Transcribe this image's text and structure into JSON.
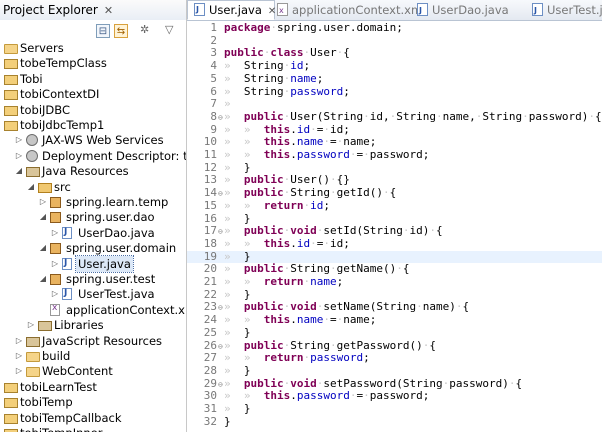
{
  "explorer": {
    "title": "Project Explorer",
    "close_glyph": "✕",
    "toolbar": {
      "collapse_all": "⊟",
      "link_with_editor": "⇆",
      "view_menu": "▽"
    },
    "tree": [
      {
        "depth": 0,
        "label": "Servers",
        "icon": "folder",
        "arrow": ""
      },
      {
        "depth": 0,
        "label": "tobeTempClass",
        "icon": "project-folder",
        "arrow": ""
      },
      {
        "depth": 0,
        "label": "Tobi",
        "icon": "project-folder",
        "arrow": ""
      },
      {
        "depth": 0,
        "label": "tobiContextDI",
        "icon": "project-folder",
        "arrow": ""
      },
      {
        "depth": 0,
        "label": "tobiJDBC",
        "icon": "project-folder",
        "arrow": ""
      },
      {
        "depth": 0,
        "label": "tobiJdbcTemp1",
        "icon": "project-folder",
        "arrow": ""
      },
      {
        "depth": 1,
        "label": "JAX-WS Web Services",
        "icon": "gear",
        "arrow": "▷"
      },
      {
        "depth": 1,
        "label": "Deployment Descriptor: tobiJdbc",
        "icon": "gear",
        "arrow": "▷"
      },
      {
        "depth": 1,
        "label": "Java Resources",
        "icon": "java-resources",
        "arrow": "◢"
      },
      {
        "depth": 2,
        "label": "src",
        "icon": "source-folder",
        "arrow": "◢"
      },
      {
        "depth": 3,
        "label": "spring.learn.temp",
        "icon": "package",
        "arrow": "▷"
      },
      {
        "depth": 3,
        "label": "spring.user.dao",
        "icon": "package",
        "arrow": "◢"
      },
      {
        "depth": 4,
        "label": "UserDao.java",
        "icon": "java-file",
        "arrow": "▷"
      },
      {
        "depth": 3,
        "label": "spring.user.domain",
        "icon": "package",
        "arrow": "◢"
      },
      {
        "depth": 4,
        "label": "User.java",
        "icon": "java-file",
        "arrow": "▷",
        "selected": true
      },
      {
        "depth": 3,
        "label": "spring.user.test",
        "icon": "package",
        "arrow": "◢"
      },
      {
        "depth": 4,
        "label": "UserTest.java",
        "icon": "java-file",
        "arrow": "▷"
      },
      {
        "depth": 3,
        "label": "applicationContext.xml",
        "icon": "xml-file",
        "arrow": ""
      },
      {
        "depth": 2,
        "label": "Libraries",
        "icon": "libraries",
        "arrow": "▷"
      },
      {
        "depth": 1,
        "label": "JavaScript Resources",
        "icon": "libraries",
        "arrow": "▷"
      },
      {
        "depth": 1,
        "label": "build",
        "icon": "folder",
        "arrow": "▷"
      },
      {
        "depth": 1,
        "label": "WebContent",
        "icon": "folder",
        "arrow": "▷"
      },
      {
        "depth": 0,
        "label": "tobiLearnTest",
        "icon": "project-folder",
        "arrow": ""
      },
      {
        "depth": 0,
        "label": "tobiTemp",
        "icon": "project-folder",
        "arrow": ""
      },
      {
        "depth": 0,
        "label": "tobiTempCallback",
        "icon": "project-folder",
        "arrow": ""
      },
      {
        "depth": 0,
        "label": "tobiTempInner",
        "icon": "project-folder",
        "arrow": ""
      }
    ]
  },
  "editor": {
    "tabs": [
      {
        "label": "User.java",
        "icon": "java-file",
        "active": true,
        "close_glyph": "✕"
      },
      {
        "label": "applicationContext.xml",
        "icon": "xml-file",
        "active": false
      },
      {
        "label": "UserDao.java",
        "icon": "java-file",
        "active": false
      },
      {
        "label": "UserTest.java",
        "icon": "java-file",
        "active": false
      }
    ],
    "lines": [
      {
        "n": "1",
        "fold": "",
        "code": [
          [
            "kw",
            "package"
          ],
          [
            "ws",
            "·"
          ],
          [
            "t",
            "spring.user.domain;"
          ]
        ]
      },
      {
        "n": "2",
        "fold": "",
        "code": []
      },
      {
        "n": "3",
        "fold": "",
        "code": [
          [
            "kw",
            "public"
          ],
          [
            "ws",
            "·"
          ],
          [
            "kw",
            "class"
          ],
          [
            "ws",
            "·"
          ],
          [
            "t",
            "User"
          ],
          [
            "ws",
            "·"
          ],
          [
            "t",
            "{"
          ]
        ]
      },
      {
        "n": "4",
        "fold": "",
        "code": [
          [
            "ws",
            "»  "
          ],
          [
            "t",
            "String"
          ],
          [
            "ws",
            "·"
          ],
          [
            "fld",
            "id"
          ],
          [
            "t",
            ";"
          ]
        ]
      },
      {
        "n": "5",
        "fold": "",
        "code": [
          [
            "ws",
            "»  "
          ],
          [
            "t",
            "String"
          ],
          [
            "ws",
            "·"
          ],
          [
            "fld",
            "name"
          ],
          [
            "t",
            ";"
          ]
        ]
      },
      {
        "n": "6",
        "fold": "",
        "code": [
          [
            "ws",
            "»  "
          ],
          [
            "t",
            "String"
          ],
          [
            "ws",
            "·"
          ],
          [
            "fld",
            "password"
          ],
          [
            "t",
            ";"
          ]
        ]
      },
      {
        "n": "7",
        "fold": "",
        "code": [
          [
            "ws",
            "»"
          ]
        ]
      },
      {
        "n": "8",
        "fold": "⊖",
        "code": [
          [
            "ws",
            "»  "
          ],
          [
            "kw",
            "public"
          ],
          [
            "ws",
            "·"
          ],
          [
            "t",
            "User(String"
          ],
          [
            "ws",
            "·"
          ],
          [
            "t",
            "id,"
          ],
          [
            "ws",
            "·"
          ],
          [
            "t",
            "String"
          ],
          [
            "ws",
            "·"
          ],
          [
            "t",
            "name,"
          ],
          [
            "ws",
            "·"
          ],
          [
            "t",
            "String"
          ],
          [
            "ws",
            "·"
          ],
          [
            "t",
            "password)"
          ],
          [
            "ws",
            "·"
          ],
          [
            "t",
            "{"
          ]
        ]
      },
      {
        "n": "9",
        "fold": "",
        "code": [
          [
            "ws",
            "»  »  "
          ],
          [
            "kw",
            "this"
          ],
          [
            "t",
            "."
          ],
          [
            "fld",
            "id"
          ],
          [
            "ws",
            "·"
          ],
          [
            "t",
            "="
          ],
          [
            "ws",
            "·"
          ],
          [
            "t",
            "id;"
          ]
        ]
      },
      {
        "n": "10",
        "fold": "",
        "code": [
          [
            "ws",
            "»  »  "
          ],
          [
            "kw",
            "this"
          ],
          [
            "t",
            "."
          ],
          [
            "fld",
            "name"
          ],
          [
            "ws",
            "·"
          ],
          [
            "t",
            "="
          ],
          [
            "ws",
            "·"
          ],
          [
            "t",
            "name;"
          ]
        ]
      },
      {
        "n": "11",
        "fold": "",
        "code": [
          [
            "ws",
            "»  »  "
          ],
          [
            "kw",
            "this"
          ],
          [
            "t",
            "."
          ],
          [
            "fld",
            "password"
          ],
          [
            "ws",
            "·"
          ],
          [
            "t",
            "="
          ],
          [
            "ws",
            "·"
          ],
          [
            "t",
            "password;"
          ]
        ]
      },
      {
        "n": "12",
        "fold": "",
        "code": [
          [
            "ws",
            "»  "
          ],
          [
            "t",
            "}"
          ]
        ]
      },
      {
        "n": "13",
        "fold": "",
        "code": [
          [
            "ws",
            "»  "
          ],
          [
            "kw",
            "public"
          ],
          [
            "ws",
            "·"
          ],
          [
            "t",
            "User()"
          ],
          [
            "ws",
            "·"
          ],
          [
            "t",
            "{}"
          ]
        ]
      },
      {
        "n": "14",
        "fold": "⊖",
        "code": [
          [
            "ws",
            "»  "
          ],
          [
            "kw",
            "public"
          ],
          [
            "ws",
            "·"
          ],
          [
            "t",
            "String"
          ],
          [
            "ws",
            "·"
          ],
          [
            "t",
            "getId()"
          ],
          [
            "ws",
            "·"
          ],
          [
            "t",
            "{"
          ]
        ]
      },
      {
        "n": "15",
        "fold": "",
        "code": [
          [
            "ws",
            "»  »  "
          ],
          [
            "kw",
            "return"
          ],
          [
            "ws",
            "·"
          ],
          [
            "fld",
            "id"
          ],
          [
            "t",
            ";"
          ]
        ]
      },
      {
        "n": "16",
        "fold": "",
        "code": [
          [
            "ws",
            "»  "
          ],
          [
            "t",
            "}"
          ]
        ]
      },
      {
        "n": "17",
        "fold": "⊖",
        "code": [
          [
            "ws",
            "»  "
          ],
          [
            "kw",
            "public"
          ],
          [
            "ws",
            "·"
          ],
          [
            "kw",
            "void"
          ],
          [
            "ws",
            "·"
          ],
          [
            "t",
            "setId(String"
          ],
          [
            "ws",
            "·"
          ],
          [
            "t",
            "id)"
          ],
          [
            "ws",
            "·"
          ],
          [
            "t",
            "{"
          ]
        ]
      },
      {
        "n": "18",
        "fold": "",
        "code": [
          [
            "ws",
            "»  »  "
          ],
          [
            "kw",
            "this"
          ],
          [
            "t",
            "."
          ],
          [
            "fld",
            "id"
          ],
          [
            "ws",
            "·"
          ],
          [
            "t",
            "="
          ],
          [
            "ws",
            "·"
          ],
          [
            "t",
            "id;"
          ]
        ]
      },
      {
        "n": "19",
        "fold": "",
        "hl": true,
        "code": [
          [
            "ws",
            "»  "
          ],
          [
            "t",
            "}"
          ]
        ]
      },
      {
        "n": "20",
        "fold": "",
        "code": [
          [
            "ws",
            "»  "
          ],
          [
            "kw",
            "public"
          ],
          [
            "ws",
            "·"
          ],
          [
            "t",
            "String"
          ],
          [
            "ws",
            "·"
          ],
          [
            "t",
            "getName()"
          ],
          [
            "ws",
            "·"
          ],
          [
            "t",
            "{"
          ]
        ]
      },
      {
        "n": "21",
        "fold": "",
        "code": [
          [
            "ws",
            "»  »  "
          ],
          [
            "kw",
            "return"
          ],
          [
            "ws",
            "·"
          ],
          [
            "fld",
            "name"
          ],
          [
            "t",
            ";"
          ]
        ]
      },
      {
        "n": "22",
        "fold": "",
        "code": [
          [
            "ws",
            "»  "
          ],
          [
            "t",
            "}"
          ]
        ]
      },
      {
        "n": "23",
        "fold": "⊖",
        "code": [
          [
            "ws",
            "»  "
          ],
          [
            "kw",
            "public"
          ],
          [
            "ws",
            "·"
          ],
          [
            "kw",
            "void"
          ],
          [
            "ws",
            "·"
          ],
          [
            "t",
            "setName(String"
          ],
          [
            "ws",
            "·"
          ],
          [
            "t",
            "name)"
          ],
          [
            "ws",
            "·"
          ],
          [
            "t",
            "{"
          ]
        ]
      },
      {
        "n": "24",
        "fold": "",
        "code": [
          [
            "ws",
            "»  »  "
          ],
          [
            "kw",
            "this"
          ],
          [
            "t",
            "."
          ],
          [
            "fld",
            "name"
          ],
          [
            "ws",
            "·"
          ],
          [
            "t",
            "="
          ],
          [
            "ws",
            "·"
          ],
          [
            "t",
            "name;"
          ]
        ]
      },
      {
        "n": "25",
        "fold": "",
        "code": [
          [
            "ws",
            "»  "
          ],
          [
            "t",
            "}"
          ]
        ]
      },
      {
        "n": "26",
        "fold": "⊖",
        "code": [
          [
            "ws",
            "»  "
          ],
          [
            "kw",
            "public"
          ],
          [
            "ws",
            "·"
          ],
          [
            "t",
            "String"
          ],
          [
            "ws",
            "·"
          ],
          [
            "t",
            "getPassword()"
          ],
          [
            "ws",
            "·"
          ],
          [
            "t",
            "{"
          ]
        ]
      },
      {
        "n": "27",
        "fold": "",
        "code": [
          [
            "ws",
            "»  »  "
          ],
          [
            "kw",
            "return"
          ],
          [
            "ws",
            "·"
          ],
          [
            "fld",
            "password"
          ],
          [
            "t",
            ";"
          ]
        ]
      },
      {
        "n": "28",
        "fold": "",
        "code": [
          [
            "ws",
            "»  "
          ],
          [
            "t",
            "}"
          ]
        ]
      },
      {
        "n": "29",
        "fold": "⊖",
        "code": [
          [
            "ws",
            "»  "
          ],
          [
            "kw",
            "public"
          ],
          [
            "ws",
            "·"
          ],
          [
            "kw",
            "void"
          ],
          [
            "ws",
            "·"
          ],
          [
            "t",
            "setPassword(String"
          ],
          [
            "ws",
            "·"
          ],
          [
            "t",
            "password)"
          ],
          [
            "ws",
            "·"
          ],
          [
            "t",
            "{"
          ]
        ]
      },
      {
        "n": "30",
        "fold": "",
        "code": [
          [
            "ws",
            "»  »  "
          ],
          [
            "kw",
            "this"
          ],
          [
            "t",
            "."
          ],
          [
            "fld",
            "password"
          ],
          [
            "ws",
            "·"
          ],
          [
            "t",
            "="
          ],
          [
            "ws",
            "·"
          ],
          [
            "t",
            "password;"
          ]
        ]
      },
      {
        "n": "31",
        "fold": "",
        "code": [
          [
            "ws",
            "»  "
          ],
          [
            "t",
            "}"
          ]
        ]
      },
      {
        "n": "32",
        "fold": "",
        "code": [
          [
            "t",
            "}"
          ]
        ]
      }
    ]
  }
}
